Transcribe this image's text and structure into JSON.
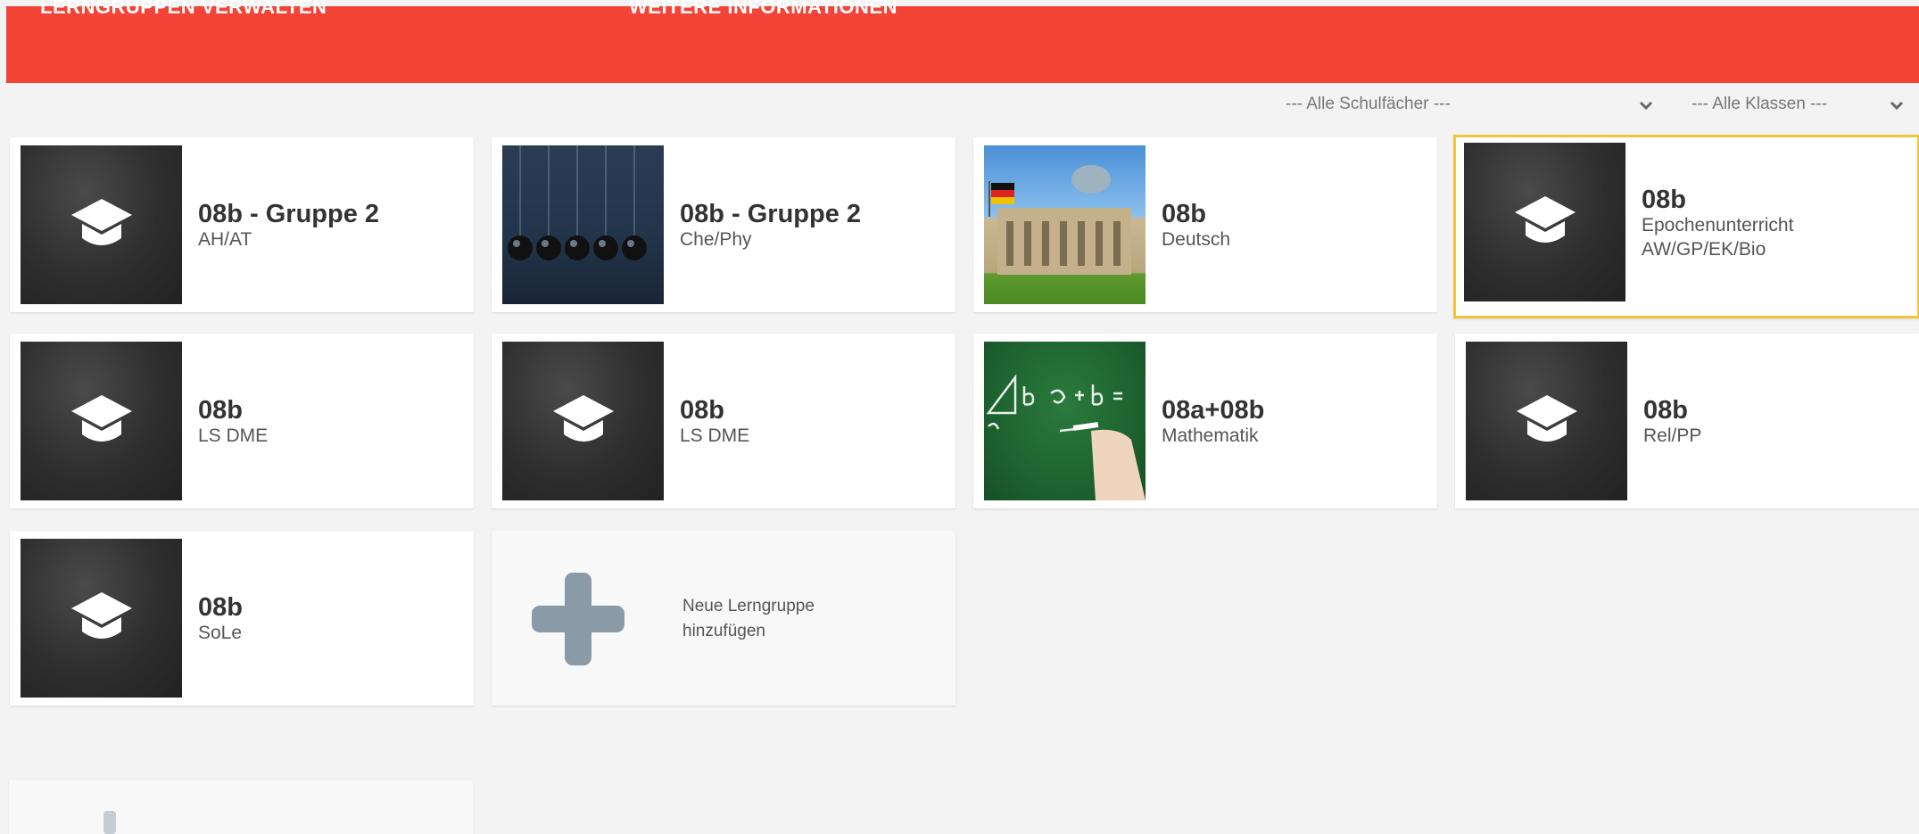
{
  "nav": {
    "items": [
      "LERNGRUPPEN VERWALTEN",
      "WEITERE INFORMATIONEN"
    ]
  },
  "filters": {
    "subject": "--- Alle Schulfächer ---",
    "class": "--- Alle Klassen ---"
  },
  "colors": {
    "header": "#f44337",
    "selected_border": "#f0c53c",
    "plus": "#8a9aa6"
  },
  "cards": [
    {
      "title": "08b - Gruppe 2",
      "subtitle": "AH/AT",
      "image": "graduation-cap-icon"
    },
    {
      "title": "08b - Gruppe 2",
      "subtitle": "Che/Phy",
      "image": "newtons-cradle-photo"
    },
    {
      "title": "08b",
      "subtitle": "Deutsch",
      "image": "reichstag-photo"
    },
    {
      "title": "08b",
      "subtitle": "Epochenunterricht\nAW/GP/EK/Bio",
      "image": "graduation-cap-icon"
    },
    {
      "title": "08b",
      "subtitle": "LS DME",
      "image": "graduation-cap-icon"
    },
    {
      "title": "08b",
      "subtitle": "LS DME",
      "image": "graduation-cap-icon"
    },
    {
      "title": "08a+08b",
      "subtitle": "Mathematik",
      "image": "chalkboard-formula-photo"
    },
    {
      "title": "08b",
      "subtitle": "Rel/PP",
      "image": "graduation-cap-icon"
    },
    {
      "title": "08b",
      "subtitle": "SoLe",
      "image": "graduation-cap-icon"
    }
  ],
  "add_card": {
    "label": "Neue Lerngruppe\nhinzufügen",
    "icon": "plus-icon"
  }
}
